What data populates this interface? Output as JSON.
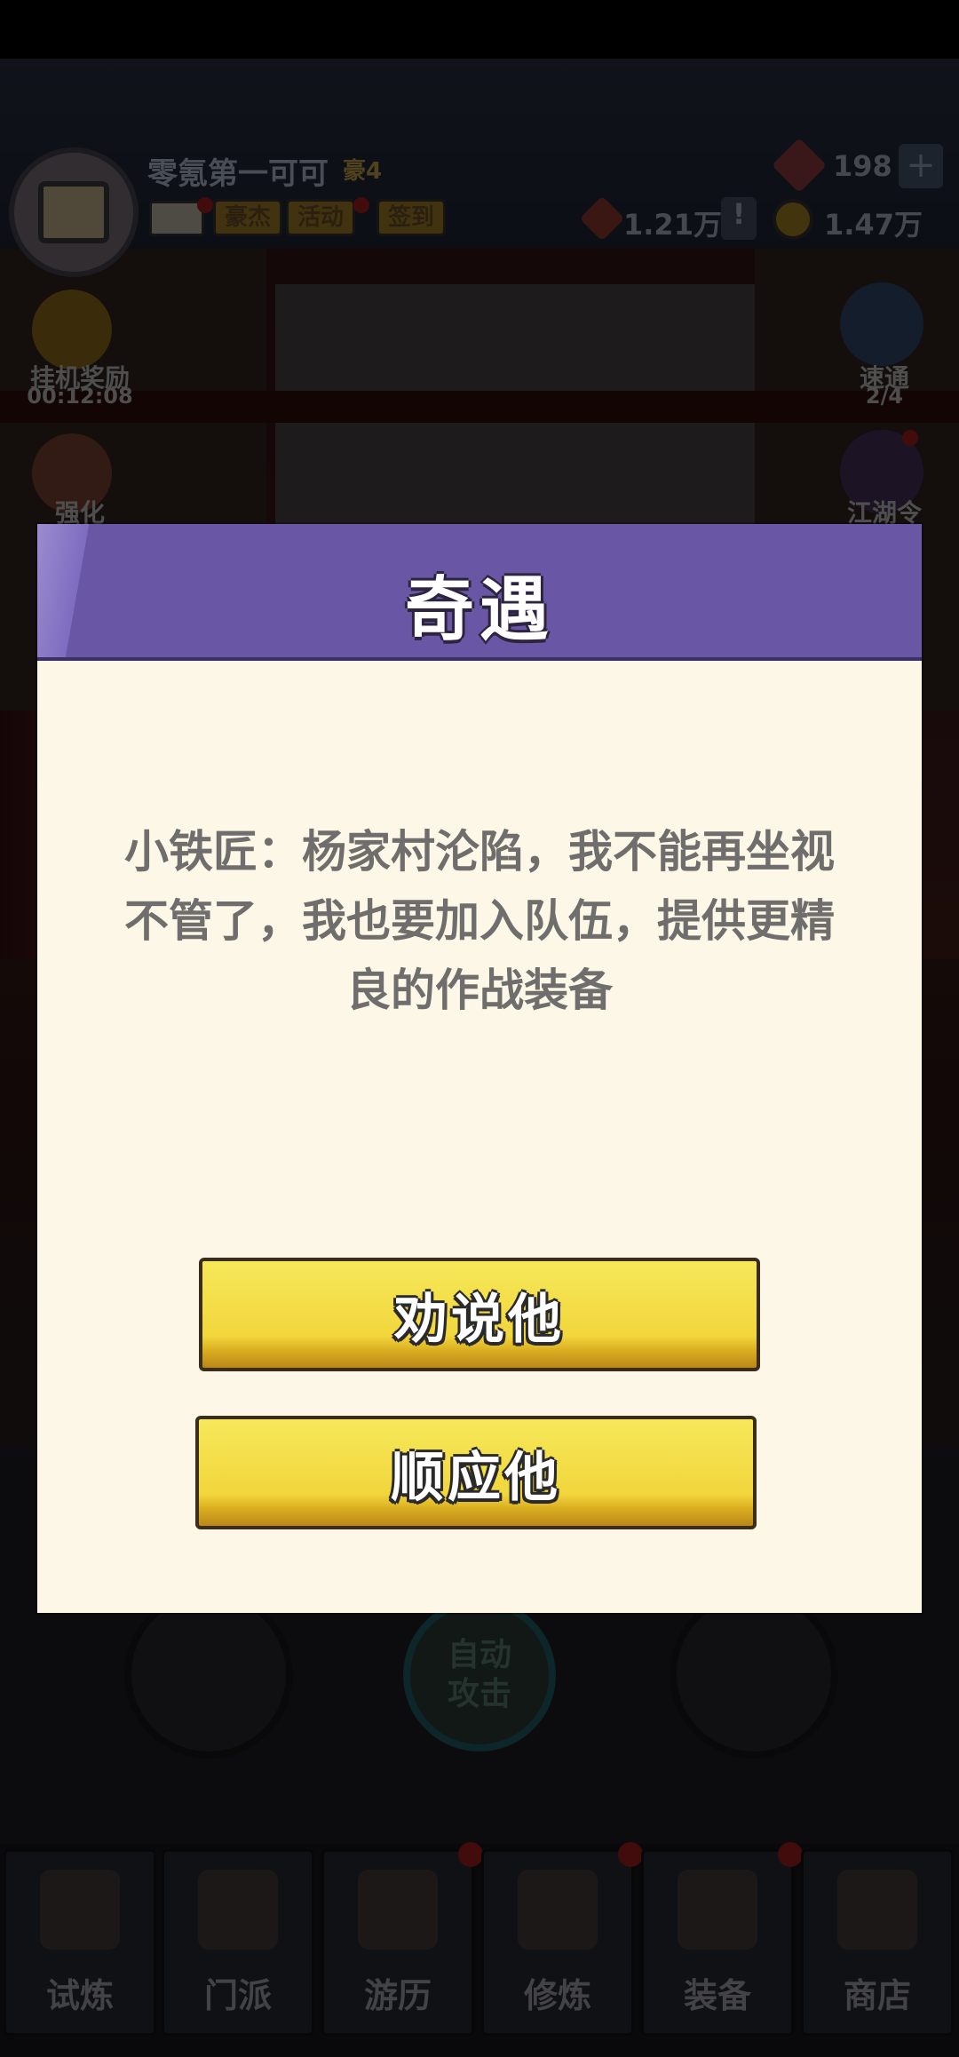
{
  "player": {
    "name": "零氪第一可可",
    "vip": "豪4",
    "buttons": [
      "豪杰",
      "活动",
      "签到"
    ]
  },
  "currency": {
    "gems": "198",
    "tokens": "1.21万",
    "coins": "1.47万",
    "info_badge": "!"
  },
  "side_left": [
    {
      "label": "挂机奖励",
      "sub": "00:12:08"
    },
    {
      "label": "强化"
    }
  ],
  "side_right": [
    {
      "label": "速通",
      "sub": "2/4"
    },
    {
      "label": "江湖令"
    }
  ],
  "controls": {
    "auto_attack": "自动\n攻击"
  },
  "nav": {
    "tabs": [
      {
        "label": "试炼",
        "icon": "ninja-icon"
      },
      {
        "label": "门派",
        "icon": "temple-icon"
      },
      {
        "label": "游历",
        "icon": "landscape-icon"
      },
      {
        "label": "修炼",
        "icon": "scroll-icon"
      },
      {
        "label": "装备",
        "icon": "sword-icon"
      },
      {
        "label": "商店",
        "icon": "shop-icon"
      }
    ]
  },
  "dialog": {
    "title": "奇遇",
    "message": "小铁匠：杨家村沦陷，我不能再坐视不管了，我也要加入队伍，提供更精良的作战装备",
    "choices": [
      "劝说他",
      "顺应他"
    ]
  },
  "colors": {
    "header": "#6956a4",
    "panel": "#fdf7e7",
    "button": "#f2d63c"
  }
}
